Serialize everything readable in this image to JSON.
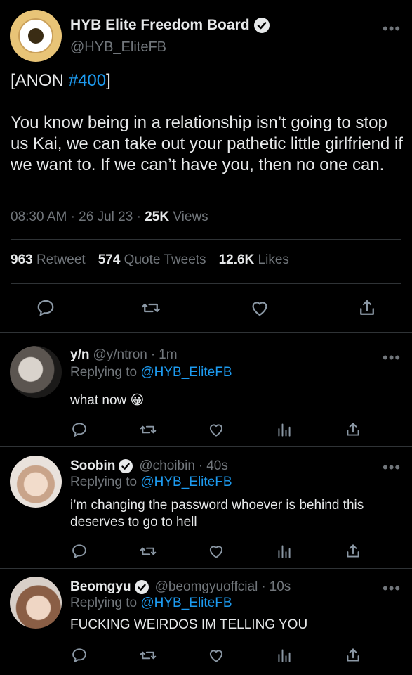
{
  "main_tweet": {
    "display_name": "HYB Elite Freedom Board",
    "handle": "@HYB_EliteFB",
    "text_prefix": "[ANON ",
    "text_hashtag": "#400",
    "text_suffix": "]",
    "body": "You know being in a relationship isn’t going to stop us Kai, we can take out your pathetic little girlfriend if we want to. If we can’t have you, then no one can.",
    "time": "08:30 AM",
    "date": "26 Jul 23",
    "views_count": "25K",
    "views_label": "Views",
    "retweets_count": "963",
    "retweets_label": "Retweet",
    "quotes_count": "574",
    "quotes_label": "Quote Tweets",
    "likes_count": "12.6K",
    "likes_label": "Likes"
  },
  "replies": [
    {
      "name": "y/n",
      "handle": "@y/ntron",
      "time": "1m",
      "replying_prefix": "Replying to",
      "replying_to": "@HYB_EliteFB",
      "text": "what now 😀",
      "verified": false
    },
    {
      "name": "Soobin",
      "handle": "@choibin",
      "time": "40s",
      "replying_prefix": "Replying to",
      "replying_to": "@HYB_EliteFB",
      "text": "i’m changing the password whoever is behind this deserves to go to hell",
      "verified": true
    },
    {
      "name": "Beomgyu",
      "handle": "@beomgyuoffcial",
      "time": "10s",
      "replying_prefix": "Replying to",
      "replying_to": "@HYB_EliteFB",
      "text": "FUCKING WEIRDOS IM TELLING YOU",
      "verified": true
    }
  ],
  "more_label": "•••",
  "separator": "·",
  "icons": {
    "reply": "reply-icon",
    "retweet": "retweet-icon",
    "like": "heart-icon",
    "analytics": "analytics-icon",
    "share": "share-icon",
    "verified": "verified-badge-icon"
  },
  "colors": {
    "background": "#000000",
    "text": "#e7e9ea",
    "muted": "#71767b",
    "link": "#1d9bf0",
    "divider": "#2f3336"
  }
}
